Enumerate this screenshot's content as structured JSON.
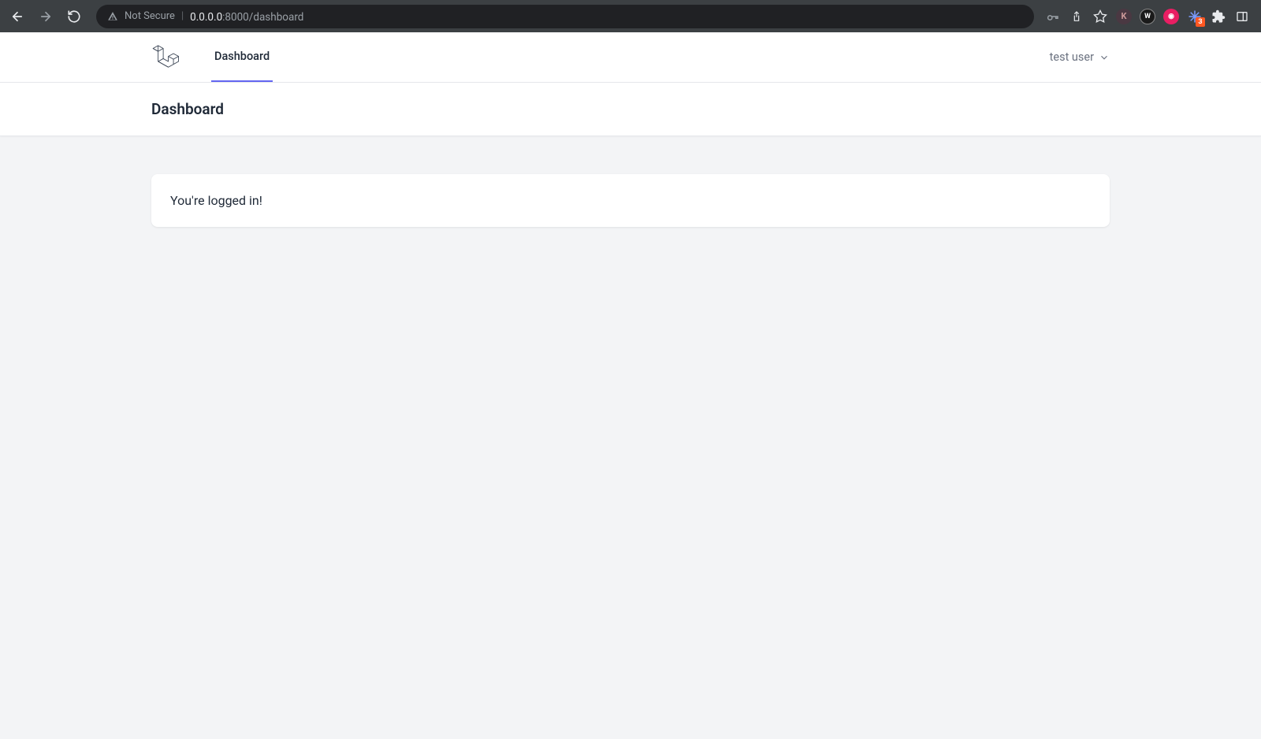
{
  "browser": {
    "not_secure_label": "Not Secure",
    "url_host": "0.0.0.0",
    "url_port_path": ":8000/dashboard",
    "badge_count": "3"
  },
  "nav": {
    "dashboard_label": "Dashboard",
    "user_name": "test user"
  },
  "header": {
    "title": "Dashboard"
  },
  "content": {
    "logged_in_message": "You're logged in!"
  }
}
